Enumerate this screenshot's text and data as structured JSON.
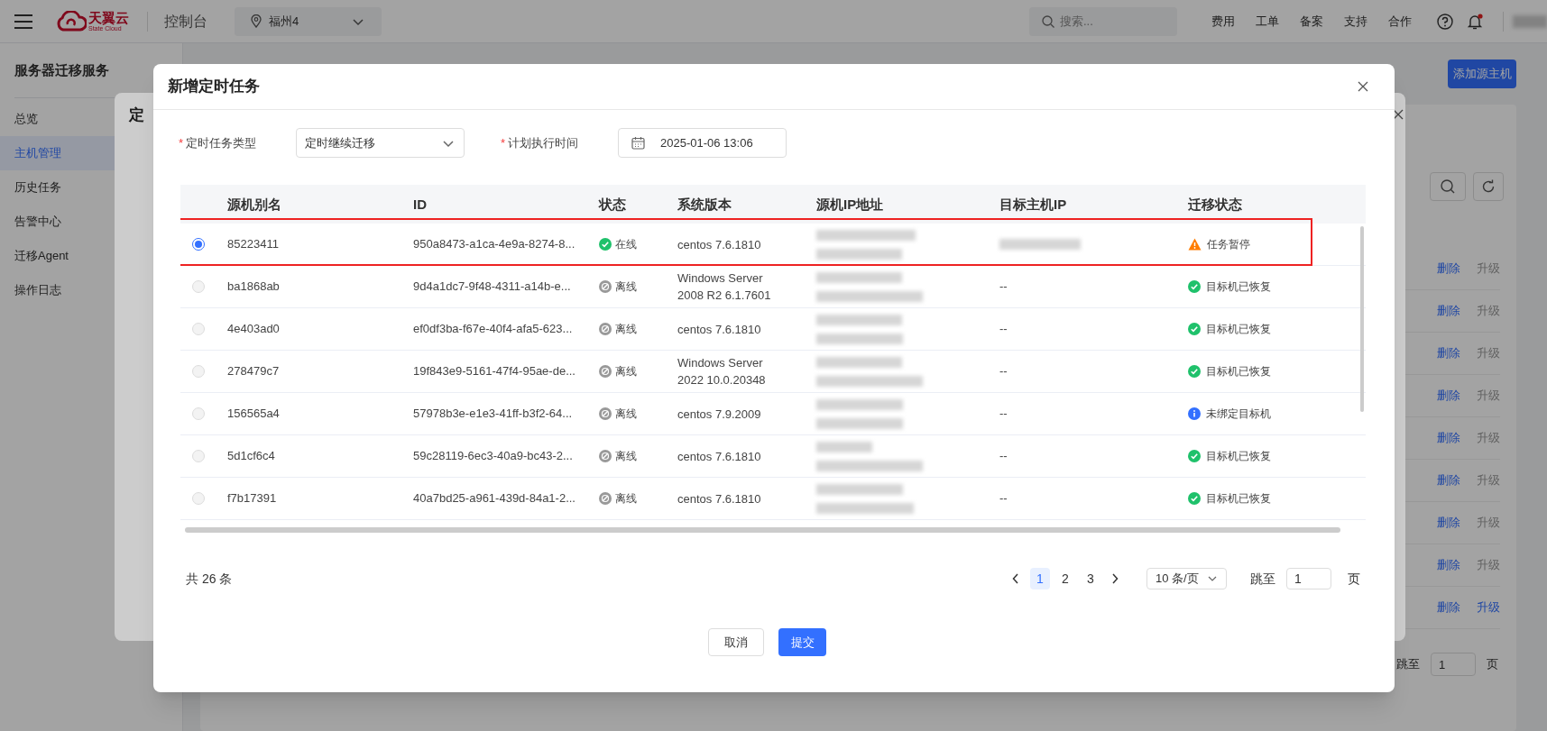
{
  "top_bar": {
    "brand": "天翼云",
    "brand_sub": "State Cloud",
    "console": "控制台",
    "region": "福州4",
    "search_placeholder": "搜索...",
    "links": [
      "费用",
      "工单",
      "备案",
      "支持",
      "合作"
    ],
    "notification_dot": true
  },
  "sidebar": {
    "title": "服务器迁移服务",
    "items": [
      {
        "label": "总览",
        "selected": false
      },
      {
        "label": "主机管理",
        "selected": true
      },
      {
        "label": "历史任务",
        "selected": false
      },
      {
        "label": "告警中心",
        "selected": false
      },
      {
        "label": "迁移Agent",
        "selected": false
      },
      {
        "label": "操作日志",
        "selected": false
      }
    ]
  },
  "page": {
    "add_button": "添加源主机",
    "row_actions": [
      {
        "delete": "删除",
        "upgrade": "升级",
        "upgrade_enabled": false
      },
      {
        "delete": "删除",
        "upgrade": "升级",
        "upgrade_enabled": false
      },
      {
        "delete": "删除",
        "upgrade": "升级",
        "upgrade_enabled": false
      },
      {
        "delete": "删除",
        "upgrade": "升级",
        "upgrade_enabled": false
      },
      {
        "delete": "删除",
        "upgrade": "升级",
        "upgrade_enabled": false
      },
      {
        "delete": "删除",
        "upgrade": "升级",
        "upgrade_enabled": false
      },
      {
        "delete": "删除",
        "upgrade": "升级",
        "upgrade_enabled": false
      },
      {
        "delete": "删除",
        "upgrade": "升级",
        "upgrade_enabled": false
      },
      {
        "delete": "删除",
        "upgrade": "升级",
        "upgrade_enabled": true
      }
    ],
    "jump_label": "跳至",
    "jump_value": "1",
    "page_unit": "页"
  },
  "back_dialog": {
    "title": "定"
  },
  "dialog": {
    "title": "新增定时任务",
    "form": [
      {
        "required_mark": "*",
        "label": "定时任务类型",
        "kind": "select",
        "value": "定时继续迁移"
      },
      {
        "required_mark": "*",
        "label": "计划执行时间",
        "kind": "date",
        "value": "2025-01-06 13:06"
      }
    ],
    "table": {
      "columns": [
        "源机别名",
        "ID",
        "状态",
        "系统版本",
        "源机IP地址",
        "目标主机IP",
        "迁移状态"
      ],
      "rows": [
        {
          "selected": true,
          "highlighted": true,
          "alias": "85223411",
          "id": "950a8473-a1ca-4e9a-8274-8...",
          "status": {
            "kind": "online",
            "label": "在线"
          },
          "os": "centos 7.6.1810",
          "target_ip_redacted": true,
          "migration": {
            "kind": "paused",
            "label": "任务暂停"
          }
        },
        {
          "selected": false,
          "highlighted": false,
          "alias": "ba1868ab",
          "id": "9d4a1dc7-9f48-4311-a14b-e...",
          "status": {
            "kind": "offline",
            "label": "离线"
          },
          "os": "Windows Server 2008 R2 6.1.7601",
          "target_ip": "--",
          "target_ip_redacted": false,
          "migration": {
            "kind": "recovered",
            "label": "目标机已恢复"
          }
        },
        {
          "selected": false,
          "highlighted": false,
          "alias": "4e403ad0",
          "id": "ef0df3ba-f67e-40f4-afa5-623...",
          "status": {
            "kind": "offline",
            "label": "离线"
          },
          "os": "centos 7.6.1810",
          "target_ip": "--",
          "target_ip_redacted": false,
          "migration": {
            "kind": "recovered",
            "label": "目标机已恢复"
          }
        },
        {
          "selected": false,
          "highlighted": false,
          "alias": "278479c7",
          "id": "19f843e9-5161-47f4-95ae-de...",
          "status": {
            "kind": "offline",
            "label": "离线"
          },
          "os": "Windows Server 2022 10.0.20348",
          "target_ip": "--",
          "target_ip_redacted": false,
          "migration": {
            "kind": "recovered",
            "label": "目标机已恢复"
          }
        },
        {
          "selected": false,
          "highlighted": false,
          "alias": "156565a4",
          "id": "57978b3e-e1e3-41ff-b3f2-64...",
          "status": {
            "kind": "offline",
            "label": "离线"
          },
          "os": "centos 7.9.2009",
          "target_ip": "--",
          "target_ip_redacted": false,
          "migration": {
            "kind": "unbound",
            "label": "未绑定目标机"
          }
        },
        {
          "selected": false,
          "highlighted": false,
          "alias": "5d1cf6c4",
          "id": "59c28119-6ec3-40a9-bc43-2...",
          "status": {
            "kind": "offline",
            "label": "离线"
          },
          "os": "centos 7.6.1810",
          "target_ip": "--",
          "target_ip_redacted": false,
          "migration": {
            "kind": "recovered",
            "label": "目标机已恢复"
          }
        },
        {
          "selected": false,
          "highlighted": false,
          "alias": "f7b17391",
          "id": "40a7bd25-a961-439d-84a1-2...",
          "status": {
            "kind": "offline",
            "label": "离线"
          },
          "os": "centos 7.6.1810",
          "target_ip": "--",
          "target_ip_redacted": false,
          "migration": {
            "kind": "recovered",
            "label": "目标机已恢复"
          }
        }
      ]
    },
    "pagination": {
      "total": "共 26 条",
      "pages": [
        {
          "label": "1",
          "selected": true
        },
        {
          "label": "2",
          "selected": false
        },
        {
          "label": "3",
          "selected": false
        }
      ],
      "page_size": "10 条/页",
      "jump_label": "跳至",
      "jump_value": "1",
      "page_unit": "页"
    },
    "buttons": [
      {
        "kind": "secondary",
        "label": "取消"
      },
      {
        "kind": "primary",
        "label": "提交"
      }
    ]
  }
}
